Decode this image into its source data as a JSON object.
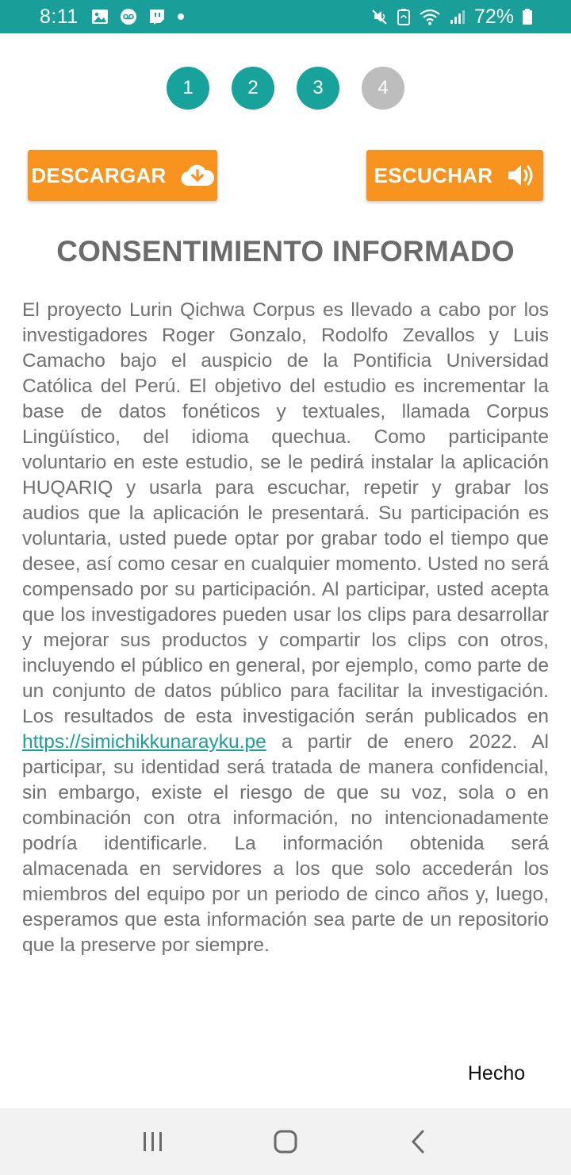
{
  "status_bar": {
    "time": "8:11",
    "battery": "72%",
    "left_icons": [
      "image-icon",
      "voicemail-icon",
      "twitch-icon",
      "dot-icon"
    ],
    "right_icons": [
      "mute-icon",
      "battery-saver-icon",
      "wifi-icon",
      "signal-icon",
      "battery-icon"
    ]
  },
  "steps": [
    {
      "label": "1",
      "active": true
    },
    {
      "label": "2",
      "active": true
    },
    {
      "label": "3",
      "active": true
    },
    {
      "label": "4",
      "active": false
    }
  ],
  "buttons": {
    "download": {
      "label": "DESCARGAR",
      "icon": "cloud-download-icon"
    },
    "listen": {
      "label": "ESCUCHAR",
      "icon": "volume-icon"
    }
  },
  "title": "CONSENTIMIENTO INFORMADO",
  "body": {
    "text_before_link": "El proyecto Lurin Qichwa Corpus es llevado a cabo por los investigadores Roger Gonzalo, Rodolfo Zevallos y Luis Camacho bajo el auspicio de la Pontificia Universidad Católica del Perú. El objetivo del estudio es incrementar la base de datos fonéticos y textuales, llamada Corpus Lingüístico, del idioma quechua. Como participante voluntario en este estudio, se le pedirá instalar la aplicación HUQARIQ y usarla para escuchar, repetir y grabar los audios que la aplicación le presentará. Su participación es voluntaria, usted puede optar por grabar todo el tiempo que desee, así como cesar en cualquier momento. Usted no será compensado por su participación. Al participar, usted acepta que los investigadores pueden usar los clips para desarrollar y mejorar sus productos y compartir los clips con otros, incluyendo el público en general, por ejemplo, como parte de un conjunto de datos público para facilitar la investigación. Los resultados de esta investigación serán publicados en ",
    "link_text": "https://simichikkunarayku.pe",
    "text_after_link": " a partir de enero 2022. Al participar, su identidad será tratada de manera confidencial, sin embargo, existe el riesgo de que su voz, sola o en combinación con otra información, no intencionadamente podría identificarle. La información obtenida será almacenada en servidores a los que solo accederán los miembros del equipo por un periodo de cinco años y, luego, esperamos que esta información sea parte de un repositorio que la preserve por siempre."
  },
  "done_label": "Hecho",
  "nav": {
    "recents": "recents-icon",
    "home": "home-icon",
    "back": "back-icon"
  },
  "colors": {
    "status_bar": "#1a9e9a",
    "step_active": "#17a39c",
    "step_inactive": "#bdbdbd",
    "button": "#f7931e",
    "link": "#1a9e9a"
  }
}
